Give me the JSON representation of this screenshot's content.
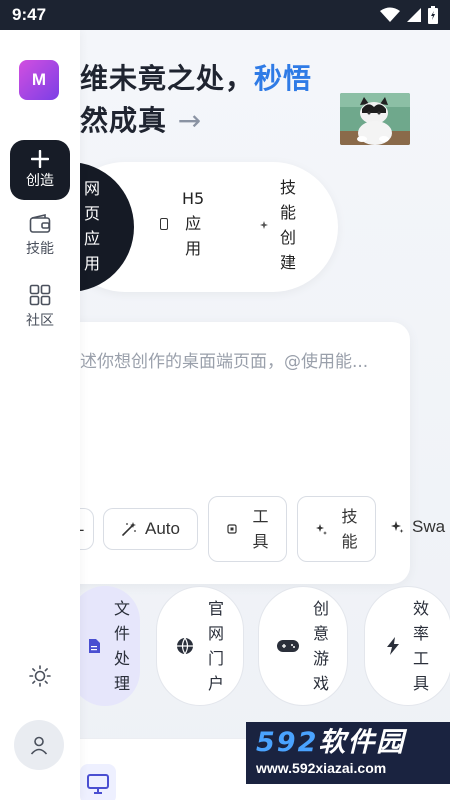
{
  "status": {
    "time": "9:47"
  },
  "headline": {
    "line1_prefix": "维未竟之处，",
    "line1_accent": "秒悟",
    "line2": "然成真",
    "arrow": "→"
  },
  "modes": {
    "active": [
      "网",
      "页",
      "应",
      "用"
    ],
    "h5": [
      "H5",
      "应",
      "用"
    ],
    "skill": [
      "技",
      "能",
      "创",
      "建"
    ]
  },
  "prompt": {
    "placeholder": "述你想创作的桌面端页面，@使用能..."
  },
  "chips": {
    "edge": "-",
    "auto": "Auto",
    "tool": [
      "工",
      "具"
    ],
    "skill": [
      "技",
      "能"
    ],
    "swap": "Swa"
  },
  "categories": {
    "file": [
      "文",
      "件",
      "处",
      "理"
    ],
    "portal": [
      "官",
      "网",
      "门",
      "户"
    ],
    "game": [
      "创",
      "意",
      "游",
      "戏"
    ],
    "efficiency": [
      "效",
      "率",
      "工",
      "具"
    ]
  },
  "sidebar": {
    "avatar": "M",
    "create": "创造",
    "skill": "技能",
    "community": "社区"
  },
  "watermark": {
    "num": "592",
    "cn": "软件园",
    "url": "www.592xiazai.com"
  },
  "icons": {
    "wifi": "wifi-icon",
    "signal": "signal-icon",
    "battery": "battery-icon",
    "plus": "plus-icon",
    "wallet": "wallet-icon",
    "grid": "grid-icon",
    "sun": "sun-icon",
    "user": "user-icon",
    "wand": "magic-wand-icon",
    "chip": "chip-icon",
    "sparkle": "sparkle-icon",
    "doc": "document-icon",
    "globe": "globe-icon",
    "gamepad": "gamepad-icon",
    "bolt": "bolt-icon",
    "monitor": "monitor-icon"
  },
  "colors": {
    "accent": "#2f7be6",
    "dark": "#151a25",
    "file_bg": "#e6e6fb"
  }
}
